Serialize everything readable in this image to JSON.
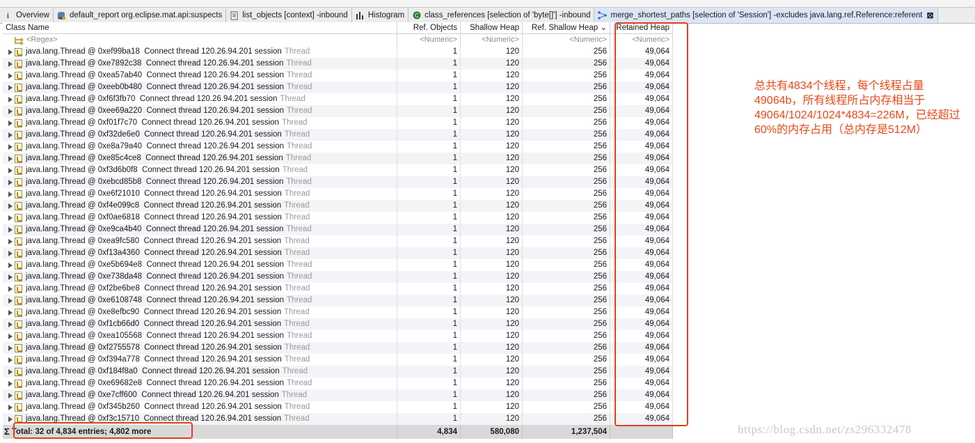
{
  "tabs": [
    {
      "label": "Overview",
      "icon": "info-icon"
    },
    {
      "label": "default_report  org.eclipse.mat.api:suspects",
      "icon": "report-icon"
    },
    {
      "label": "list_objects [context] -inbound",
      "icon": "list-icon"
    },
    {
      "label": "Histogram",
      "icon": "histogram-icon"
    },
    {
      "label": "class_references [selection of 'byte[]'] -inbound",
      "icon": "class-icon"
    },
    {
      "label": "merge_shortest_paths [selection of 'Session'] -excludes java.lang.ref.Reference:referent",
      "icon": "merge-paths-icon",
      "active": true
    }
  ],
  "columns": {
    "class_name": "Class Name",
    "ref_objects": "Ref. Objects",
    "shallow_heap": "Shallow Heap",
    "ref_shallow_heap": "Ref. Shallow Heap",
    "retained_heap": "Retained Heap",
    "sort_indicator": "⌄"
  },
  "filters": {
    "regex": "<Regex>",
    "numeric": "<Numeric>"
  },
  "rows": [
    {
      "addr": "java.lang.Thread @ 0xef99ba18",
      "desc": "Connect thread 120.26.94.201 session",
      "type": "Thread",
      "ref": "1",
      "shallow": "120",
      "refshallow": "256",
      "retained": "49,064"
    },
    {
      "addr": "java.lang.Thread @ 0xe7892c38",
      "desc": "Connect thread 120.26.94.201 session",
      "type": "Thread",
      "ref": "1",
      "shallow": "120",
      "refshallow": "256",
      "retained": "49,064"
    },
    {
      "addr": "java.lang.Thread @ 0xea57ab40",
      "desc": "Connect thread 120.26.94.201 session",
      "type": "Thread",
      "ref": "1",
      "shallow": "120",
      "refshallow": "256",
      "retained": "49,064"
    },
    {
      "addr": "java.lang.Thread @ 0xeeb0b480",
      "desc": "Connect thread 120.26.94.201 session",
      "type": "Thread",
      "ref": "1",
      "shallow": "120",
      "refshallow": "256",
      "retained": "49,064"
    },
    {
      "addr": "java.lang.Thread @ 0xf6f3fb70",
      "desc": "Connect thread 120.26.94.201 session",
      "type": "Thread",
      "ref": "1",
      "shallow": "120",
      "refshallow": "256",
      "retained": "49,064"
    },
    {
      "addr": "java.lang.Thread @ 0xee69a220",
      "desc": "Connect thread 120.26.94.201 session",
      "type": "Thread",
      "ref": "1",
      "shallow": "120",
      "refshallow": "256",
      "retained": "49,064"
    },
    {
      "addr": "java.lang.Thread @ 0xf01f7c70",
      "desc": "Connect thread 120.26.94.201 session",
      "type": "Thread",
      "ref": "1",
      "shallow": "120",
      "refshallow": "256",
      "retained": "49,064"
    },
    {
      "addr": "java.lang.Thread @ 0xf32de6e0",
      "desc": "Connect thread 120.26.94.201 session",
      "type": "Thread",
      "ref": "1",
      "shallow": "120",
      "refshallow": "256",
      "retained": "49,064"
    },
    {
      "addr": "java.lang.Thread @ 0xe8a79a40",
      "desc": "Connect thread 120.26.94.201 session",
      "type": "Thread",
      "ref": "1",
      "shallow": "120",
      "refshallow": "256",
      "retained": "49,064"
    },
    {
      "addr": "java.lang.Thread @ 0xe85c4ce8",
      "desc": "Connect thread 120.26.94.201 session",
      "type": "Thread",
      "ref": "1",
      "shallow": "120",
      "refshallow": "256",
      "retained": "49,064"
    },
    {
      "addr": "java.lang.Thread @ 0xf3d6b0f8",
      "desc": "Connect thread 120.26.94.201 session",
      "type": "Thread",
      "ref": "1",
      "shallow": "120",
      "refshallow": "256",
      "retained": "49,064"
    },
    {
      "addr": "java.lang.Thread @ 0xebcd85b8",
      "desc": "Connect thread 120.26.94.201 session",
      "type": "Thread",
      "ref": "1",
      "shallow": "120",
      "refshallow": "256",
      "retained": "49,064"
    },
    {
      "addr": "java.lang.Thread @ 0xe6f21010",
      "desc": "Connect thread 120.26.94.201 session",
      "type": "Thread",
      "ref": "1",
      "shallow": "120",
      "refshallow": "256",
      "retained": "49,064"
    },
    {
      "addr": "java.lang.Thread @ 0xf4e099c8",
      "desc": "Connect thread 120.26.94.201 session",
      "type": "Thread",
      "ref": "1",
      "shallow": "120",
      "refshallow": "256",
      "retained": "49,064"
    },
    {
      "addr": "java.lang.Thread @ 0xf0ae6818",
      "desc": "Connect thread 120.26.94.201 session",
      "type": "Thread",
      "ref": "1",
      "shallow": "120",
      "refshallow": "256",
      "retained": "49,064"
    },
    {
      "addr": "java.lang.Thread @ 0xe9ca4b40",
      "desc": "Connect thread 120.26.94.201 session",
      "type": "Thread",
      "ref": "1",
      "shallow": "120",
      "refshallow": "256",
      "retained": "49,064"
    },
    {
      "addr": "java.lang.Thread @ 0xea9fc580",
      "desc": "Connect thread 120.26.94.201 session",
      "type": "Thread",
      "ref": "1",
      "shallow": "120",
      "refshallow": "256",
      "retained": "49,064"
    },
    {
      "addr": "java.lang.Thread @ 0xf13a4360",
      "desc": "Connect thread 120.26.94.201 session",
      "type": "Thread",
      "ref": "1",
      "shallow": "120",
      "refshallow": "256",
      "retained": "49,064"
    },
    {
      "addr": "java.lang.Thread @ 0xe5b694e8",
      "desc": "Connect thread 120.26.94.201 session",
      "type": "Thread",
      "ref": "1",
      "shallow": "120",
      "refshallow": "256",
      "retained": "49,064"
    },
    {
      "addr": "java.lang.Thread @ 0xe738da48",
      "desc": "Connect thread 120.26.94.201 session",
      "type": "Thread",
      "ref": "1",
      "shallow": "120",
      "refshallow": "256",
      "retained": "49,064"
    },
    {
      "addr": "java.lang.Thread @ 0xf2be6be8",
      "desc": "Connect thread 120.26.94.201 session",
      "type": "Thread",
      "ref": "1",
      "shallow": "120",
      "refshallow": "256",
      "retained": "49,064"
    },
    {
      "addr": "java.lang.Thread @ 0xe6108748",
      "desc": "Connect thread 120.26.94.201 session",
      "type": "Thread",
      "ref": "1",
      "shallow": "120",
      "refshallow": "256",
      "retained": "49,064"
    },
    {
      "addr": "java.lang.Thread @ 0xe8efbc90",
      "desc": "Connect thread 120.26.94.201 session",
      "type": "Thread",
      "ref": "1",
      "shallow": "120",
      "refshallow": "256",
      "retained": "49,064"
    },
    {
      "addr": "java.lang.Thread @ 0xf1cb66d0",
      "desc": "Connect thread 120.26.94.201 session",
      "type": "Thread",
      "ref": "1",
      "shallow": "120",
      "refshallow": "256",
      "retained": "49,064"
    },
    {
      "addr": "java.lang.Thread @ 0xea105568",
      "desc": "Connect thread 120.26.94.201 session",
      "type": "Thread",
      "ref": "1",
      "shallow": "120",
      "refshallow": "256",
      "retained": "49,064"
    },
    {
      "addr": "java.lang.Thread @ 0xf2755578",
      "desc": "Connect thread 120.26.94.201 session",
      "type": "Thread",
      "ref": "1",
      "shallow": "120",
      "refshallow": "256",
      "retained": "49,064"
    },
    {
      "addr": "java.lang.Thread @ 0xf394a778",
      "desc": "Connect thread 120.26.94.201 session",
      "type": "Thread",
      "ref": "1",
      "shallow": "120",
      "refshallow": "256",
      "retained": "49,064"
    },
    {
      "addr": "java.lang.Thread @ 0xf184f8a0",
      "desc": "Connect thread 120.26.94.201 session",
      "type": "Thread",
      "ref": "1",
      "shallow": "120",
      "refshallow": "256",
      "retained": "49,064"
    },
    {
      "addr": "java.lang.Thread @ 0xe69682e8",
      "desc": "Connect thread 120.26.94.201 session",
      "type": "Thread",
      "ref": "1",
      "shallow": "120",
      "refshallow": "256",
      "retained": "49,064"
    },
    {
      "addr": "java.lang.Thread @ 0xe7cff600",
      "desc": "Connect thread 120.26.94.201 session",
      "type": "Thread",
      "ref": "1",
      "shallow": "120",
      "refshallow": "256",
      "retained": "49,064"
    },
    {
      "addr": "java.lang.Thread @ 0xf345b260",
      "desc": "Connect thread 120.26.94.201 session",
      "type": "Thread",
      "ref": "1",
      "shallow": "120",
      "refshallow": "256",
      "retained": "49,064"
    },
    {
      "addr": "java.lang.Thread @ 0xf3c15710",
      "desc": "Connect thread 120.26.94.201 session",
      "type": "Thread",
      "ref": "1",
      "shallow": "120",
      "refshallow": "256",
      "retained": "49,064"
    }
  ],
  "total": {
    "label": "Total: 32 of 4,834 entries; 4,802 more",
    "ref": "4,834",
    "shallow": "580,080",
    "refshallow": "1,237,504",
    "retained": ""
  },
  "annotation": {
    "text": "总共有4834个线程，每个线程占量49064b，所有线程所占内存相当于49064/1024/1024*4834=226M，已经超过60%的内存占用（总内存是512M）",
    "color": "#e8481a"
  },
  "watermark": "https://blog.csdn.net/zs296332478",
  "colors": {
    "highlight_box": "#e0401a",
    "active_tab": "#dbe6f5",
    "total_row": "#d9d9d9"
  }
}
